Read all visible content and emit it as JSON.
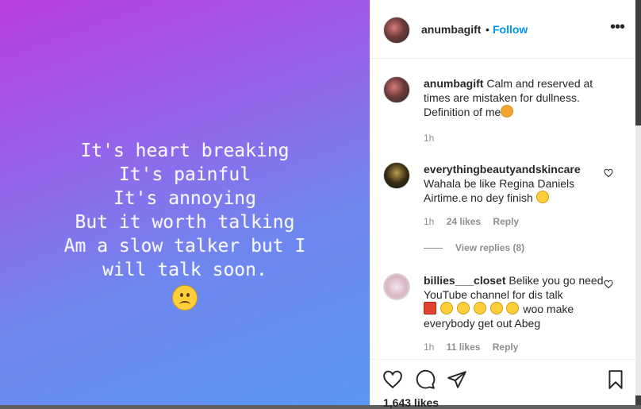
{
  "media": {
    "lines": [
      "It's heart breaking",
      "It's painful",
      "It's annoying",
      "But it worth talking",
      "Am a slow talker but I",
      "will talk soon."
    ],
    "emoji_icon": "sad-face-icon"
  },
  "header": {
    "username": "anumbagift",
    "separator": "•",
    "follow_label": "Follow",
    "more_icon": "more-options-icon"
  },
  "caption": {
    "username": "anumbagift",
    "text": "Calm and reserved at times are mistaken for dullness. Definition of me",
    "time": "1h"
  },
  "comments": [
    {
      "username": "everythingbeautyandskincare",
      "text": "Wahala be like Regina Daniels Airtime.e no dey finish",
      "time": "1h",
      "likes": "24 likes",
      "reply_label": "Reply",
      "view_replies": "View replies (8)"
    },
    {
      "username": "billies___closet",
      "text_before": "Belike you go need YouTube channel for dis talk",
      "text_after": "woo make everybody get out Abeg",
      "time": "1h",
      "likes": "11 likes",
      "reply_label": "Reply"
    }
  ],
  "actions": {
    "likes_count": "1,643 likes"
  },
  "colors": {
    "follow_blue": "#0095f6",
    "text": "#262626",
    "muted": "#8e8e8e"
  }
}
